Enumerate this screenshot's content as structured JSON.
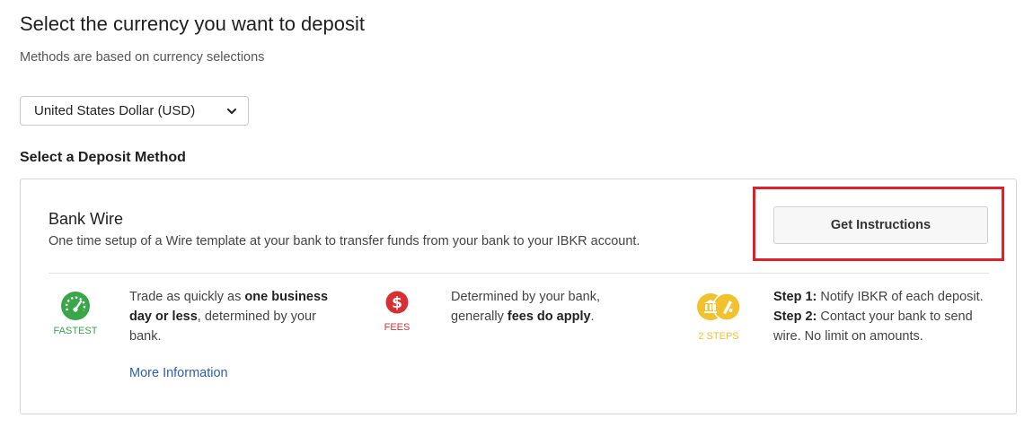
{
  "header": {
    "title": "Select the currency you want to deposit",
    "subtitle": "Methods are based on currency selections"
  },
  "currency_select": {
    "selected": "United States Dollar (USD)"
  },
  "section": {
    "title": "Select a Deposit Method"
  },
  "method": {
    "title": "Bank Wire",
    "description": "One time setup of a Wire template at your bank to transfer funds from your bank to your IBKR account.",
    "button_label": "Get Instructions",
    "features": {
      "speed": {
        "tag": "FASTEST",
        "text_prefix": "Trade as quickly as ",
        "text_bold": "one business day or less",
        "text_suffix": ", determined by your bank.",
        "link": "More Information"
      },
      "fees": {
        "tag": "FEES",
        "text_prefix": "Determined by your bank, generally ",
        "text_bold": "fees do apply",
        "text_suffix": "."
      },
      "steps": {
        "tag": "2 STEPS",
        "step1_label": "Step 1:",
        "step1_text": " Notify IBKR of each deposit.",
        "step2_label": "Step 2:",
        "step2_text": " Contact your bank to send wire. No limit on amounts."
      }
    }
  },
  "colors": {
    "fastest": "#3aa64a",
    "fees": "#d63034",
    "steps": "#f2c12e",
    "highlight": "#e0202a",
    "link": "#2b5fb3"
  }
}
